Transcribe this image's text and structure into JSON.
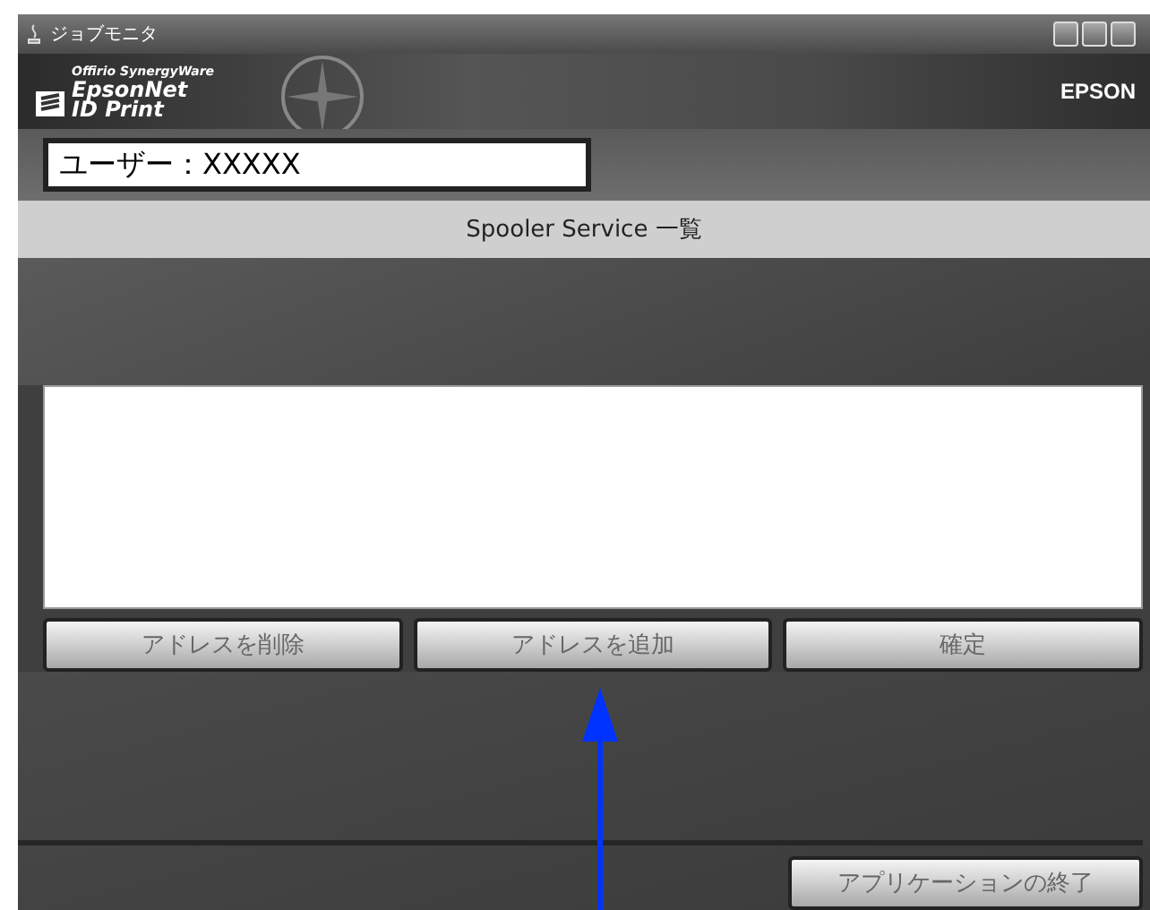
{
  "window": {
    "title": "ジョブモニタ"
  },
  "banner": {
    "tagline": "Offirio SynergyWare",
    "product_line1": "EpsonNet",
    "product_line2": "ID Print",
    "brand": "EPSON"
  },
  "user_field": {
    "value": "ユーザー：XXXXX"
  },
  "list_header": "Spooler Service 一覧",
  "buttons": [
    "アドレスを削除",
    "アドレスを追加",
    "確定"
  ],
  "exit_button": "アプリケーションの終了"
}
